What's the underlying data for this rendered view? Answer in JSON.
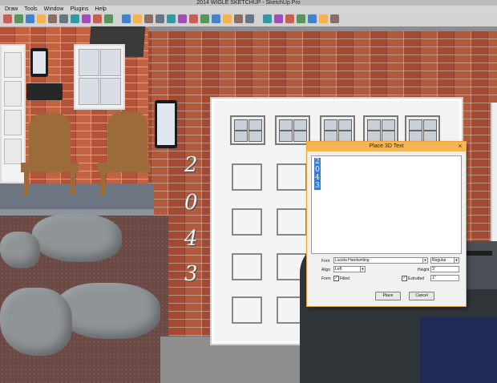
{
  "window": {
    "title": "2014 WIGLE SKETCHUP - SketchUp Pro"
  },
  "menu": [
    "Draw",
    "Tools",
    "Window",
    "Plugins",
    "Help"
  ],
  "toolbar": {
    "icons": [
      "select-icon",
      "eraser-icon",
      "paint-icon",
      "orbit-icon",
      "pan-icon",
      "zoom-icon",
      "zoom-extents-icon",
      "tape-icon",
      "text-icon",
      "section-icon",
      "iso-view-icon",
      "top-view-icon",
      "front-view-icon",
      "right-view-icon",
      "back-view-icon",
      "left-view-icon",
      "xray-icon",
      "wireframe-icon",
      "hidden-line-icon",
      "shaded-icon",
      "textured-icon",
      "monochrome-icon",
      "house-icon",
      "warehouse-icon",
      "component-icon",
      "extension-icon",
      "ruby-icon",
      "shadow-icon",
      "fog-icon"
    ]
  },
  "scene": {
    "house_numbers": [
      "2",
      "0",
      "4",
      "3"
    ]
  },
  "dialog": {
    "title": "Place 3D Text",
    "text_lines": [
      "2",
      "0",
      "4",
      "3"
    ],
    "font_label": "Font",
    "font_value": "Lucida Handwriting",
    "style_value": "Regular",
    "align_label": "Align",
    "align_value": "Left",
    "height_label": "Height",
    "height_value": "3'",
    "form_label": "Form",
    "filled_label": "Filled",
    "filled_checked": true,
    "extruded_label": "Extruded",
    "extruded_checked": true,
    "extruded_value": "1\"",
    "place_label": "Place",
    "cancel_label": "Cancel",
    "close_glyph": "×"
  }
}
